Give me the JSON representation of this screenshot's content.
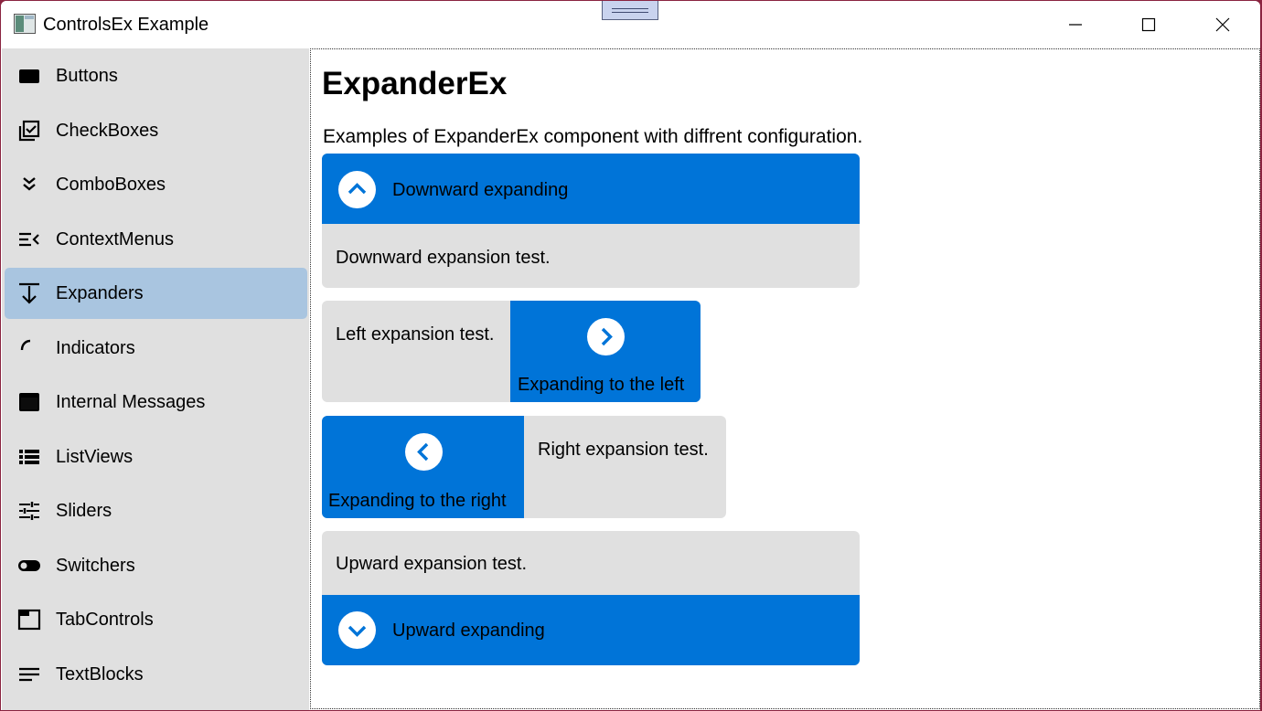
{
  "window": {
    "title": "ControlsEx Example"
  },
  "sidebar": {
    "items": [
      {
        "label": "Buttons",
        "icon": "button-icon"
      },
      {
        "label": "CheckBoxes",
        "icon": "checkbox-multiple-icon"
      },
      {
        "label": "ComboBoxes",
        "icon": "double-chevron-down-icon"
      },
      {
        "label": "ContextMenus",
        "icon": "menu-open-icon"
      },
      {
        "label": "Expanders",
        "icon": "expand-down-icon"
      },
      {
        "label": "Indicators",
        "icon": "progress-arc-icon"
      },
      {
        "label": "Internal Messages",
        "icon": "message-window-icon"
      },
      {
        "label": "ListViews",
        "icon": "list-icon"
      },
      {
        "label": "Sliders",
        "icon": "tune-sliders-icon"
      },
      {
        "label": "Switchers",
        "icon": "toggle-switch-icon"
      },
      {
        "label": "TabControls",
        "icon": "tab-icon"
      },
      {
        "label": "TextBlocks",
        "icon": "text-lines-icon"
      }
    ],
    "selected": "Expanders"
  },
  "main": {
    "title": "ExpanderEx",
    "description": "Examples of ExpanderEx component with diffrent configuration.",
    "expanders": {
      "down": {
        "header": "Downward expanding",
        "content": "Downward expansion test.",
        "icon": "chevron-up-icon"
      },
      "left": {
        "header": "Expanding to the left",
        "content": "Left expansion test.",
        "icon": "chevron-right-icon"
      },
      "right": {
        "header": "Expanding to the right",
        "content": "Right expansion test.",
        "icon": "chevron-left-icon"
      },
      "up": {
        "header": "Upward expanding",
        "content": "Upward expansion test.",
        "icon": "chevron-down-icon"
      }
    }
  },
  "colors": {
    "accent": "#0074d8",
    "selected_nav": "#a9c5e0",
    "sidebar": "#e0e0e0",
    "expander_body": "#e0e0e0"
  }
}
